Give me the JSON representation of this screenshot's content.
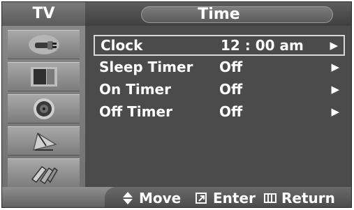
{
  "sidebar": {
    "title": "TV",
    "items": [
      {
        "icon": "input-plug-icon"
      },
      {
        "icon": "picture-icon"
      },
      {
        "icon": "speaker-icon"
      },
      {
        "icon": "antenna-dish-icon"
      },
      {
        "icon": "setup-icon"
      }
    ]
  },
  "header": {
    "title": "Time"
  },
  "menu": {
    "items": [
      {
        "label": "Clock",
        "value": "12 : 00 am",
        "arrow": "▶",
        "selected": true
      },
      {
        "label": "Sleep Timer",
        "value": "Off",
        "arrow": "▶"
      },
      {
        "label": "On Timer",
        "value": "Off",
        "arrow": "▶"
      },
      {
        "label": "Off Timer",
        "value": "Off",
        "arrow": "▶"
      }
    ]
  },
  "footer": {
    "move": "Move",
    "enter": "Enter",
    "return": "Return"
  }
}
